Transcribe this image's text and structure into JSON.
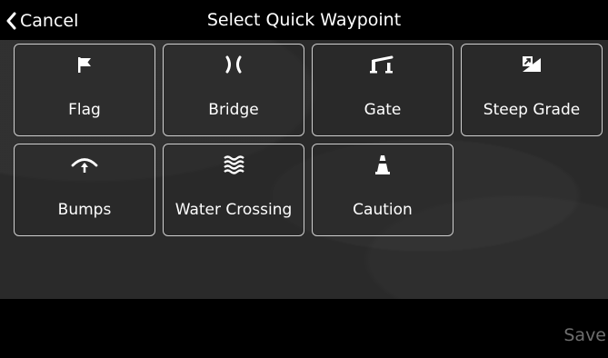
{
  "header": {
    "cancel_label": "Cancel",
    "title": "Select Quick Waypoint"
  },
  "waypoints": [
    {
      "label": "Flag",
      "icon": "flag-icon"
    },
    {
      "label": "Bridge",
      "icon": "bridge-icon"
    },
    {
      "label": "Gate",
      "icon": "gate-icon"
    },
    {
      "label": "Steep Grade",
      "icon": "steep-grade-icon"
    },
    {
      "label": "Bumps",
      "icon": "bumps-icon"
    },
    {
      "label": "Water Crossing",
      "icon": "water-crossing-icon"
    },
    {
      "label": "Caution",
      "icon": "caution-icon"
    }
  ],
  "footer": {
    "save_label": "Save"
  },
  "colors": {
    "background": "#272727",
    "bar": "#000000",
    "tile_border": "#cfcfcf",
    "text": "#ffffff",
    "save_disabled": "#6e6e6e"
  }
}
